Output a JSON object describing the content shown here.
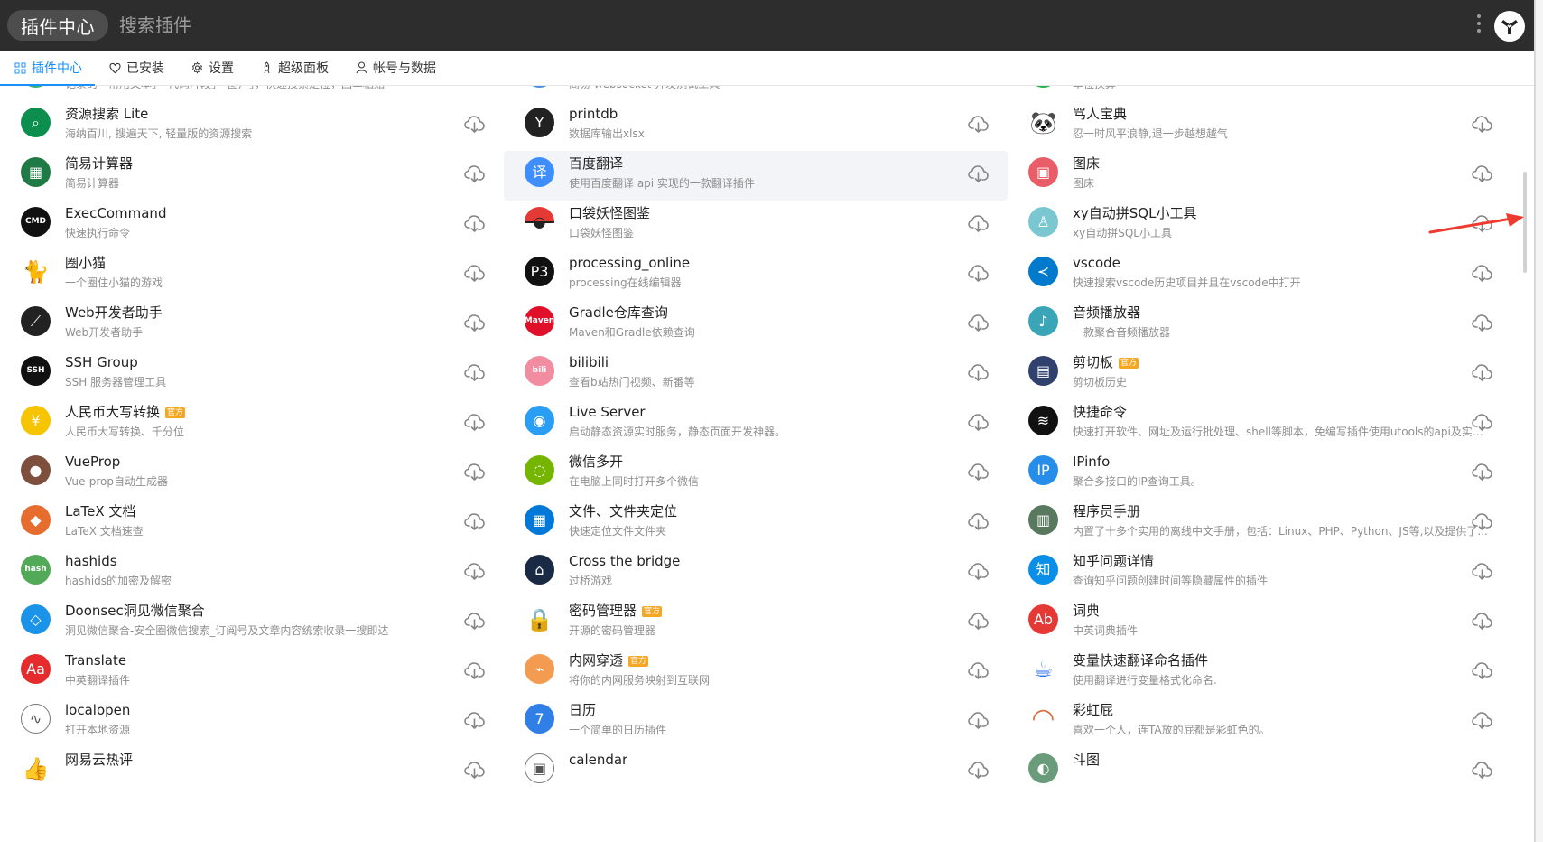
{
  "app": {
    "title": "插件中心",
    "search_placeholder": "搜索插件"
  },
  "tabs": [
    {
      "label": "插件中心",
      "icon": "grid-icon",
      "active": true
    },
    {
      "label": "已安装",
      "icon": "heart-icon",
      "active": false
    },
    {
      "label": "设置",
      "icon": "gear-icon",
      "active": false
    },
    {
      "label": "超级面板",
      "icon": "rocket-icon",
      "active": false
    },
    {
      "label": "帐号与数据",
      "icon": "user-icon",
      "active": false
    }
  ],
  "plugins": [
    [
      {
        "title": "",
        "description": "记录的「常用文本」「代码片段」「图片」，快速搜索定位，回车粘贴",
        "icon": "green-paste-icon",
        "color": "#39b56a"
      },
      {
        "title": "资源搜索 Lite",
        "description": "海纳百川, 搜遍天下, 轻量版的资源搜索",
        "icon": "green-search-icon",
        "color": "#0c8f4e"
      },
      {
        "title": "简易计算器",
        "description": "简易计算器",
        "icon": "calculator-icon",
        "color": "#1f7a45"
      },
      {
        "title": "ExecCommand",
        "description": "快速执行命令",
        "icon": "cmd-icon",
        "color": "#111111"
      },
      {
        "title": "圈小猫",
        "description": "一个圈住小猫的游戏",
        "icon": "black-cat-icon",
        "color": "#111111"
      },
      {
        "title": "Web开发者助手",
        "description": "Web开发者助手",
        "icon": "wand-icon",
        "color": "#222222"
      },
      {
        "title": "SSH Group",
        "description": "SSH 服务器管理工具",
        "icon": "ssh-icon",
        "color": "#111111"
      },
      {
        "title": "人民币大写转换",
        "description": "人民币大写转换、千分位",
        "icon": "yen-icon",
        "color": "#f6c400",
        "badge": "官方"
      },
      {
        "title": "VueProp",
        "description": "Vue-prop自动生成器",
        "icon": "anime-avatar-icon",
        "color": "#7e4f3d"
      },
      {
        "title": "LaTeX 文档",
        "description": "LaTeX 文档速查",
        "icon": "fox-avatar-icon",
        "color": "#e66d2d"
      },
      {
        "title": "hashids",
        "description": "hashids的加密及解密",
        "icon": "hash-icon",
        "color": "#52a957"
      },
      {
        "title": "Doonsec洞见微信聚合",
        "description": "洞见微信聚合-安全圈微信搜索_订阅号及文章内容统索收录一搜即达",
        "icon": "blue-diamond-icon",
        "color": "#1a93e8"
      },
      {
        "title": "Translate",
        "description": "中英翻译插件",
        "icon": "red-book-icon",
        "color": "#e52b2b"
      },
      {
        "title": "localopen",
        "description": "打开本地资源",
        "icon": "wave-icon",
        "color": "#555555"
      },
      {
        "title": "网易云热评",
        "description": "",
        "icon": "thumb-icon",
        "color": "#555555"
      }
    ],
    [
      {
        "title": "",
        "description": "简易 websocket 开发测试工具",
        "icon": "blue-chat-icon",
        "color": "#4a90e2"
      },
      {
        "title": "printdb",
        "description": "数据库输出xlsx",
        "icon": "utools-logo-icon",
        "color": "#222222"
      },
      {
        "title": "百度翻译",
        "description": "使用百度翻译 api 实现的一款翻译插件",
        "icon": "translate-icon",
        "color": "#3e8eff"
      },
      {
        "title": "口袋妖怪图鉴",
        "description": "口袋妖怪图鉴",
        "icon": "pokeball-icon",
        "color": "#e53935"
      },
      {
        "title": "processing_online",
        "description": "processing在线编辑器",
        "icon": "processing-icon",
        "color": "#111111"
      },
      {
        "title": "Gradle仓库查询",
        "description": "Maven和Gradle依赖查询",
        "icon": "maven-icon",
        "color": "#e0102b"
      },
      {
        "title": "bilibili",
        "description": "查看b站热门视频、新番等",
        "icon": "bilibili-icon",
        "color": "#f28ca0"
      },
      {
        "title": "Live Server",
        "description": "启动静态资源实时服务，静态页面开发神器。",
        "icon": "live-server-icon",
        "color": "#2a9df4"
      },
      {
        "title": "微信多开",
        "description": "在电脑上同时打开多个微信",
        "icon": "wechat-icon",
        "color": "#75b500"
      },
      {
        "title": "文件、文件夹定位",
        "description": "快速定位文件文件夹",
        "icon": "windows-icon",
        "color": "#0078d7"
      },
      {
        "title": "Cross the bridge",
        "description": "过桥游戏",
        "icon": "bridge-icon",
        "color": "#1b2a44"
      },
      {
        "title": "密码管理器",
        "description": "开源的密码管理器",
        "icon": "lock-icon",
        "color": "#4a4a4a",
        "badge": "官方"
      },
      {
        "title": "内网穿透",
        "description": "将你的内网服务映射到互联网",
        "icon": "tunnel-icon",
        "color": "#f39b51",
        "badge": "官方"
      },
      {
        "title": "日历",
        "description": "一个简单的日历插件",
        "icon": "calendar-icon",
        "color": "#2f7fe7"
      },
      {
        "title": "calendar",
        "description": "",
        "icon": "calendar-outline-icon",
        "color": "#444444"
      }
    ],
    [
      {
        "title": "",
        "description": "单位换算",
        "icon": "green-unit-icon",
        "color": "#27b34c"
      },
      {
        "title": "骂人宝典",
        "description": "忍一时风平浪静,退一步越想越气",
        "icon": "panda-icon",
        "color": "#444444"
      },
      {
        "title": "图床",
        "description": "图床",
        "icon": "image-bed-icon",
        "color": "#e85d68"
      },
      {
        "title": "xy自动拼SQL小工具",
        "description": "xy自动拼SQL小工具",
        "icon": "character-avatar-icon",
        "color": "#7ac6d1"
      },
      {
        "title": "vscode",
        "description": "快速搜索vscode历史项目并且在vscode中打开",
        "icon": "vscode-icon",
        "color": "#007acc"
      },
      {
        "title": "音频播放器",
        "description": "一款聚合音频播放器",
        "icon": "music-note-icon",
        "color": "#39a5b7"
      },
      {
        "title": "剪切板",
        "description": "剪切板历史",
        "icon": "clipboard-icon",
        "color": "#31416d",
        "badge": "官方"
      },
      {
        "title": "快捷命令",
        "description": "快速打开软件、网址及运行批处理、shell等脚本，免编写插件使用utools的api及实现...",
        "icon": "shortcut-icon",
        "color": "#111111"
      },
      {
        "title": "IPinfo",
        "description": "聚合多接口的IP查询工具。",
        "icon": "ip-icon",
        "color": "#268ee8"
      },
      {
        "title": "程序员手册",
        "description": "内置了十多个实用的离线中文手册，包括：Linux、PHP、Python、JS等,以及提供了...",
        "icon": "manual-icon",
        "color": "#59795e"
      },
      {
        "title": "知乎问题详情",
        "description": "查询知乎问题创建时间等隐藏属性的插件",
        "icon": "zhihu-icon",
        "color": "#0a8fe8"
      },
      {
        "title": "词典",
        "description": "中英词典插件",
        "icon": "dictionary-icon",
        "color": "#e53935"
      },
      {
        "title": "变量快速翻译命名插件",
        "description": "使用翻译进行变量格式化命名.",
        "icon": "coffee-cup-icon",
        "color": "#2b6de8"
      },
      {
        "title": "彩虹屁",
        "description": "喜欢一个人，连TA放的屁都是彩虹色的。",
        "icon": "rainbow-icon",
        "color": "#d96d3d"
      },
      {
        "title": "斗图",
        "description": "",
        "icon": "meme-icon",
        "color": "#6a9b7a"
      }
    ]
  ],
  "annotation": {
    "arrow_color": "#ef3a2f"
  }
}
